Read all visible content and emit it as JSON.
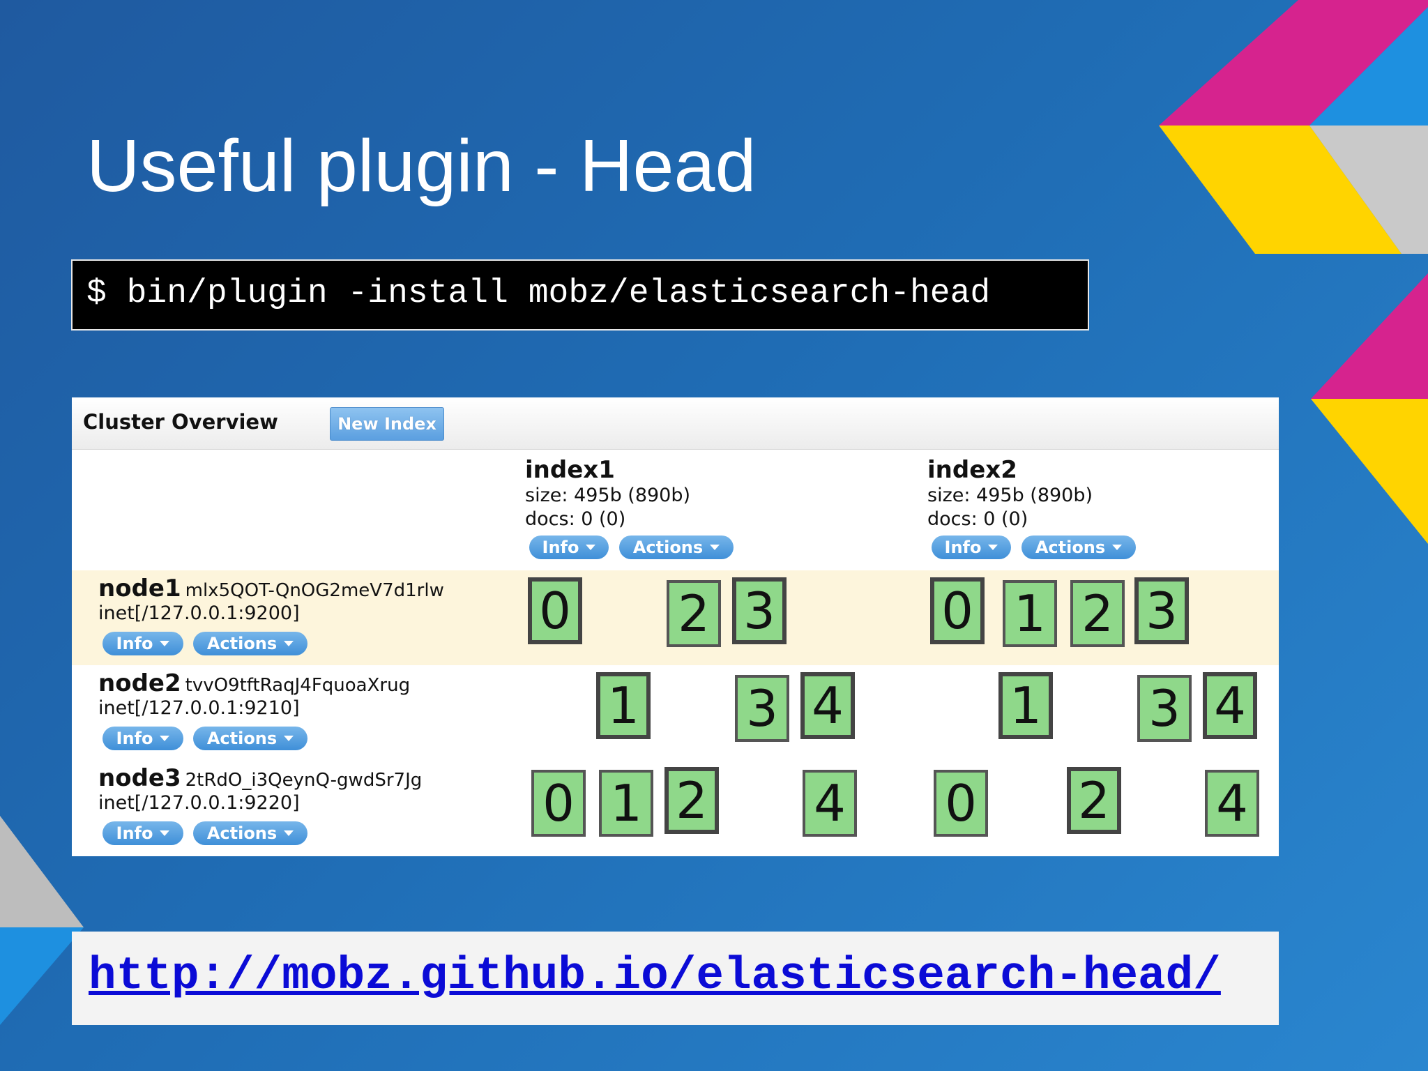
{
  "slide": {
    "title": "Useful plugin - Head",
    "command": "$ bin/plugin -install mobz/elasticsearch-head",
    "link": "http://mobz.github.io/elasticsearch-head/"
  },
  "cluster": {
    "title": "Cluster Overview",
    "new_index_label": "New Index",
    "info_label": "Info",
    "actions_label": "Actions",
    "indices": [
      {
        "name": "index1",
        "size": "size: 495b (890b)",
        "docs": "docs: 0 (0)"
      },
      {
        "name": "index2",
        "size": "size: 495b (890b)",
        "docs": "docs: 0 (0)"
      }
    ],
    "nodes": [
      {
        "name": "node1",
        "id": "mlx5QOT-QnOG2meV7d1rlw",
        "inet": "inet[/127.0.0.1:9200]"
      },
      {
        "name": "node2",
        "id": "tvvO9tftRaqJ4FquoaXrug",
        "inet": "inet[/127.0.0.1:9210]"
      },
      {
        "name": "node3",
        "id": "2tRdO_i3QeynQ-gwdSr7Jg",
        "inet": "inet[/127.0.0.1:9220]"
      }
    ],
    "shards": {
      "node1": {
        "index1": [
          "0",
          "2",
          "3"
        ],
        "index2": [
          "0",
          "1",
          "2",
          "3"
        ]
      },
      "node2": {
        "index1": [
          "1",
          "3",
          "4"
        ],
        "index2": [
          "1",
          "3",
          "4"
        ]
      },
      "node3": {
        "index1": [
          "0",
          "1",
          "2",
          "4"
        ],
        "index2": [
          "0",
          "2",
          "4"
        ]
      }
    },
    "colors": {
      "shard_fill": "#8fd88a",
      "row_highlight": "#fdf5dc",
      "button": "#4f9ce0"
    }
  }
}
